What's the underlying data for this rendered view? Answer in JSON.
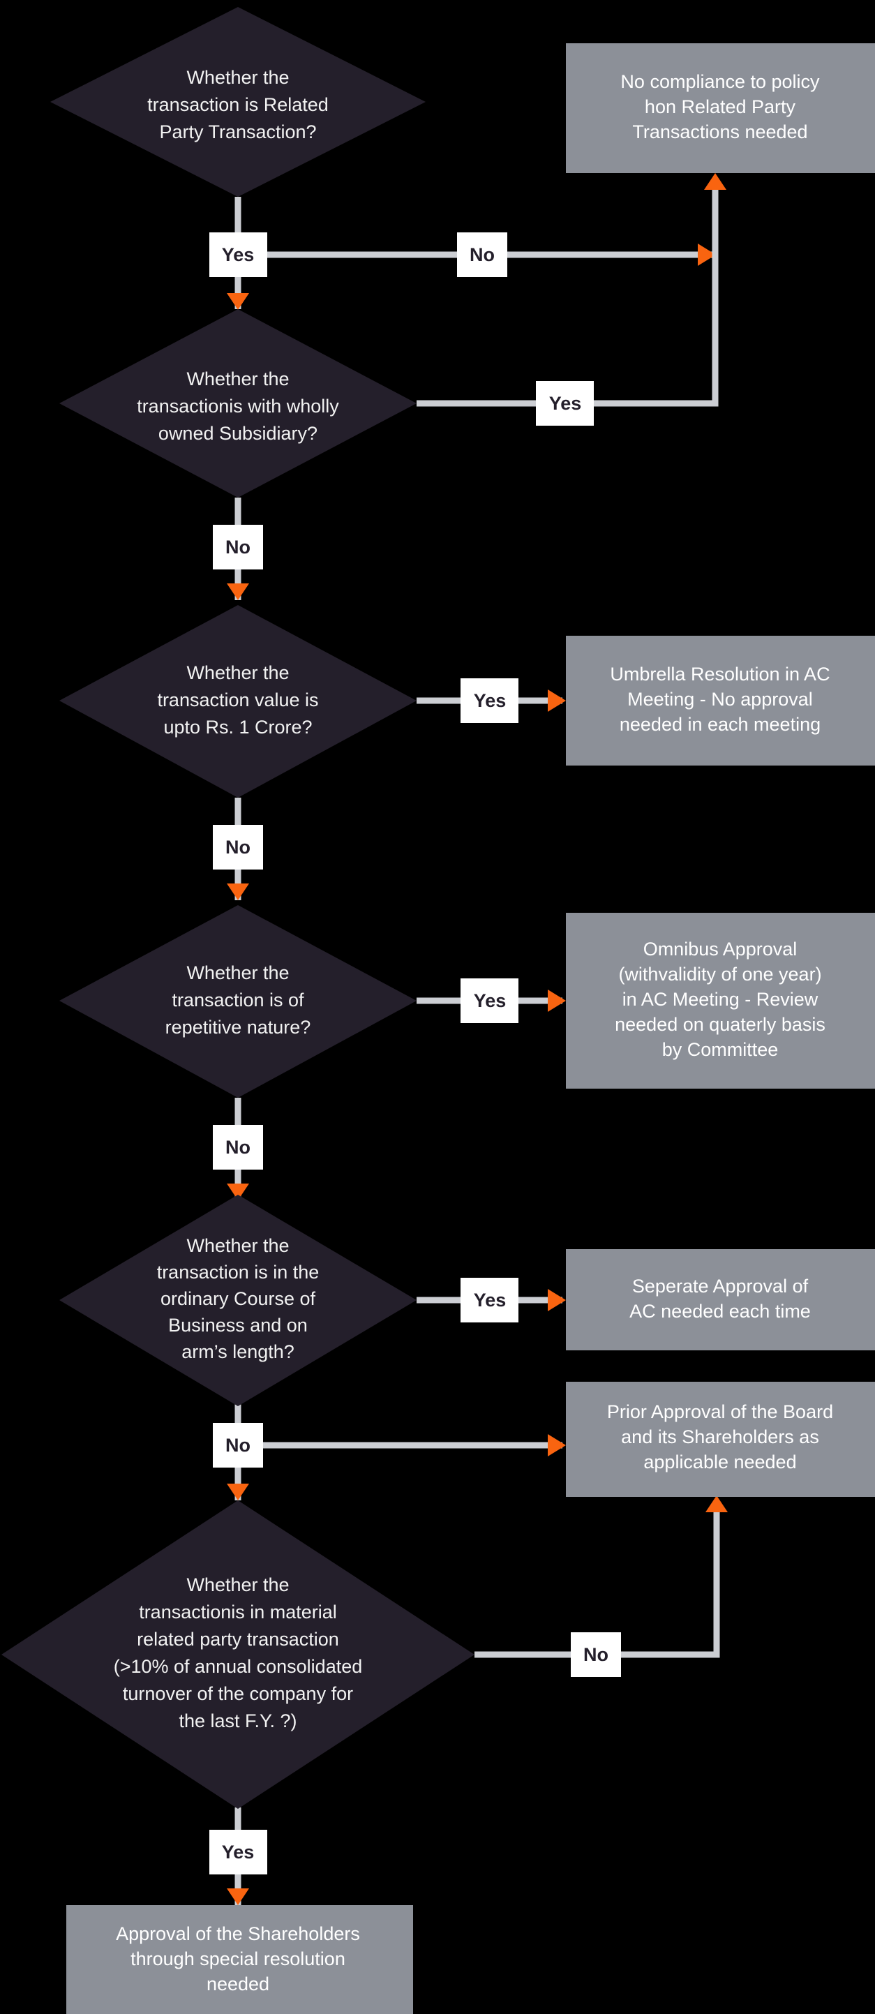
{
  "meta": {
    "title": "Related Party Transaction Approval Flowchart",
    "background_color": "#000000"
  },
  "palette": {
    "diamond_fill": "#241f2b",
    "diamond_text": "#f2f2f2",
    "result_box_fill": "#8c9098",
    "result_box_text": "#ffffff",
    "connector_line": "#ccced3",
    "arrowhead": "#f96410",
    "edge_label_bg": "#ffffff",
    "edge_label_text": "#241f2b"
  },
  "decisions": [
    {
      "id": "d1",
      "lines": [
        "Whether the",
        "transaction is Related",
        "Party Transaction?"
      ]
    },
    {
      "id": "d2",
      "lines": [
        "Whether the",
        "transactionis with wholly",
        "owned Subsidiary?"
      ]
    },
    {
      "id": "d3",
      "lines": [
        "Whether the",
        "transaction value is",
        "upto Rs. 1 Crore?"
      ]
    },
    {
      "id": "d4",
      "lines": [
        "Whether the",
        "transaction is of",
        "repetitive nature?"
      ]
    },
    {
      "id": "d5",
      "lines": [
        "Whether the",
        "transaction is in the",
        "ordinary Course of",
        "Business and on",
        "arm’s length?"
      ]
    },
    {
      "id": "d6",
      "lines": [
        "Whether the",
        "transactionis in material",
        "related party transaction",
        "(>10% of annual consolidated",
        "turnover of the company for",
        "the last F.Y. ?)"
      ]
    }
  ],
  "outcomes": [
    {
      "id": "o1",
      "lines": [
        "No compliance to policy",
        "hon Related Party",
        "Transactions needed"
      ]
    },
    {
      "id": "o2",
      "lines": [
        "Umbrella Resolution in AC",
        "Meeting - No approval",
        "needed in each meeting"
      ]
    },
    {
      "id": "o3",
      "lines": [
        "Omnibus Approval",
        "(withvalidity of one year)",
        "in AC Meeting - Review",
        "needed on quaterly basis",
        "by Committee"
      ]
    },
    {
      "id": "o4",
      "lines": [
        "Seperate Approval of",
        "AC needed each time"
      ]
    },
    {
      "id": "o5",
      "lines": [
        "Prior Approval of the Board",
        "and its Shareholders as",
        "applicable needed"
      ]
    },
    {
      "id": "o6",
      "lines": [
        "Approval of the Shareholders",
        "through special resolution",
        "needed"
      ]
    }
  ],
  "edge_labels": [
    {
      "id": "e1",
      "text": "Yes",
      "from": "d1",
      "to": "d2"
    },
    {
      "id": "e2",
      "text": "No",
      "from": "d1",
      "to": "o1"
    },
    {
      "id": "e3",
      "text": "Yes",
      "from": "d2",
      "to": "o1"
    },
    {
      "id": "e4",
      "text": "No",
      "from": "d2",
      "to": "d3"
    },
    {
      "id": "e5",
      "text": "Yes",
      "from": "d3",
      "to": "o2"
    },
    {
      "id": "e6",
      "text": "No",
      "from": "d3",
      "to": "d4"
    },
    {
      "id": "e7",
      "text": "Yes",
      "from": "d4",
      "to": "o3"
    },
    {
      "id": "e8",
      "text": "No",
      "from": "d4",
      "to": "d5"
    },
    {
      "id": "e9",
      "text": "Yes",
      "from": "d5",
      "to": "o4"
    },
    {
      "id": "e10",
      "text": "No",
      "from": "d5",
      "to": "o5"
    },
    {
      "id": "e11",
      "text": "No",
      "from": "d6",
      "to": "o5"
    },
    {
      "id": "e12",
      "text": "Yes",
      "from": "d6",
      "to": "o6"
    }
  ]
}
